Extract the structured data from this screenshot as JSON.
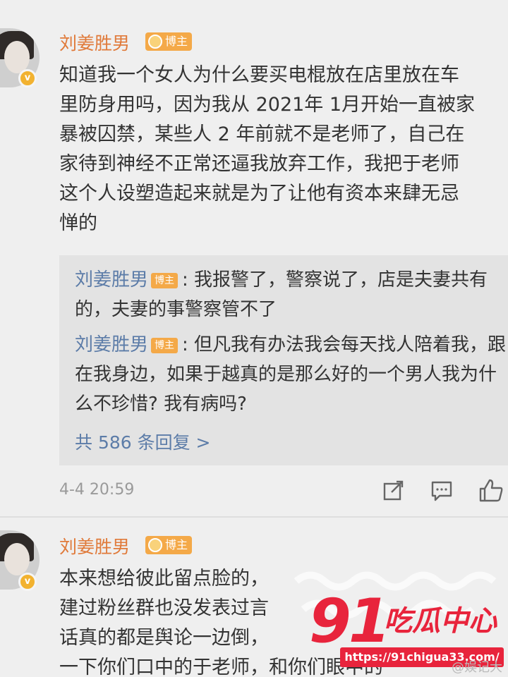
{
  "comment1": {
    "username": "刘姜胜男",
    "host_tag": "博主",
    "verify_badge": "v",
    "text": "知道我一个女人为什么要买电棍放在店里放在车\n里防身用吗，因为我从 2021年 1月开始一直被家\n暴被囚禁，某些人 2 年前就不是老师了，自己在\n家待到神经不正常还逼我放弃工作，我把于老师\n这个人设塑造起来就是为了让他有资本来肆无忌\n惮的",
    "replies": [
      {
        "name": "刘姜胜男",
        "tag": "博主",
        "text": ": 我报警了，警察说了，店是夫妻共有的，夫妻的事警察管不了"
      },
      {
        "name": "刘姜胜男",
        "tag": "博主",
        "text": ": 但凡我有办法我会每天找人陪着我，跟在我身边，如果于越真的是那么好的一个男人我为什么不珍惜? 我有病吗?"
      }
    ],
    "more_replies": "共 586 条回复 >",
    "time": "4-4 20:59",
    "actions": [
      "share-icon",
      "comment-icon",
      "like-icon"
    ]
  },
  "comment2": {
    "username": "刘姜胜男",
    "host_tag": "博主",
    "verify_badge": "v",
    "text": "本来想给彼此留点脸的，\n建过粉丝群也没发表过言\n话真的都是舆论一边倒，\n一下你们口中的于老师，和你们眼中的"
  },
  "watermark": {
    "number": "91",
    "name": "吃瓜中心",
    "url": "https://91chigua33.com/",
    "weibo": "@娱记大"
  },
  "colors": {
    "background": "#efefef",
    "username": "#e07a3a",
    "reply_name": "#5c7ca8",
    "host_tag": "#f4a948",
    "watermark_red": "#e8243c"
  }
}
